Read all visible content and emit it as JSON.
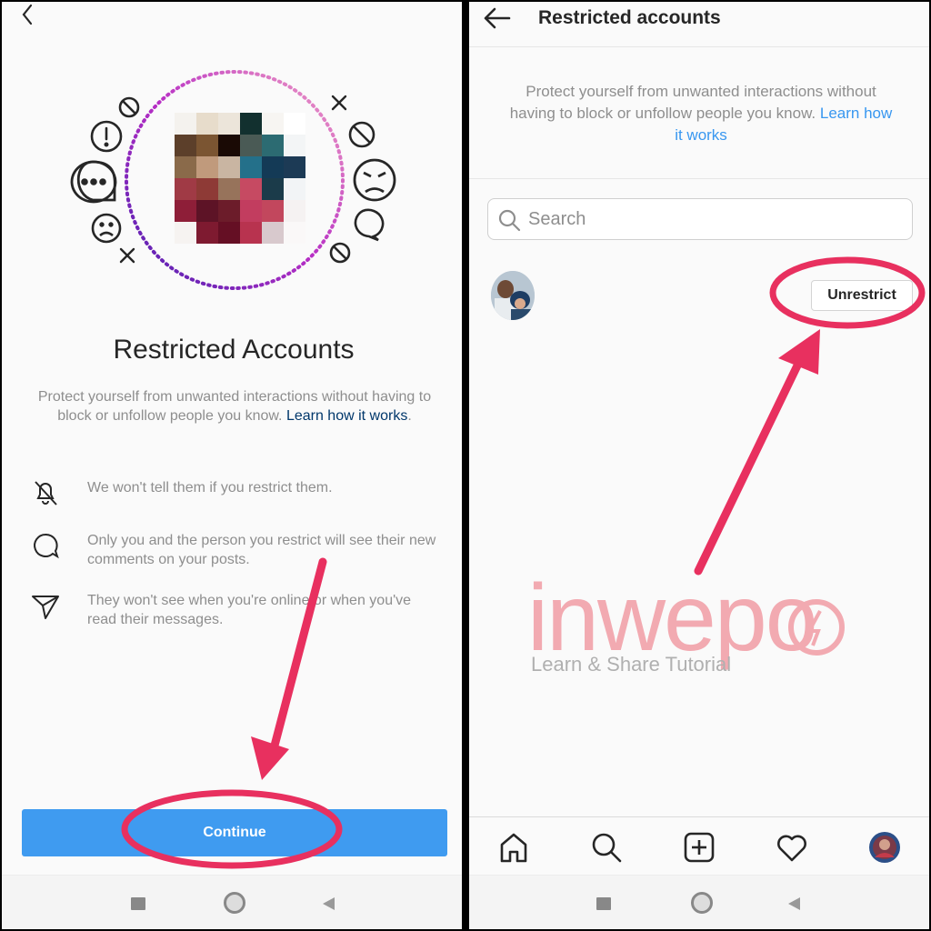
{
  "left": {
    "title": "Restricted Accounts",
    "description": "Protect yourself from unwanted interactions without having to block or unfollow people you know.",
    "link": "Learn how it works",
    "link_suffix": ".",
    "features": [
      {
        "icon": "bell-off-icon",
        "text": "We won't tell them if you restrict them."
      },
      {
        "icon": "comment-bubble-icon",
        "text": "Only you and the person you restrict will see their new comments on your posts."
      },
      {
        "icon": "paper-plane-icon",
        "text": "They won't see when you're online or when you've read their messages."
      }
    ],
    "continue_label": "Continue",
    "avatar_pixels": [
      "#f4f2ee",
      "#e7dccb",
      "#ece5da",
      "#12302f",
      "#f7f5f2",
      "#ffffff",
      "#5c3f2a",
      "#7b5532",
      "#1a0a05",
      "#4a5a55",
      "#2c6b72",
      "#f3f5f6",
      "#8a6a4a",
      "#c09a7c",
      "#c9b5a2",
      "#24708a",
      "#143a56",
      "#1c3a55",
      "#a03a45",
      "#8e3a36",
      "#97735b",
      "#c64a62",
      "#1b3b4a",
      "#f2f4f6",
      "#8e1e38",
      "#5d1326",
      "#6c1c2a",
      "#c23d5f",
      "#c2475d",
      "#f5f2f2",
      "#f6f3f1",
      "#7e1a30",
      "#650f24",
      "#b8334f",
      "#d8c9cd",
      "#faf8f8"
    ]
  },
  "right": {
    "title": "Restricted accounts",
    "description": "Protect yourself from unwanted interactions without having to block or unfollow people you know.",
    "link": "Learn how it works",
    "search_placeholder": "Search",
    "unrestrict_label": "Unrestrict",
    "tabs": [
      "home-icon",
      "search-icon",
      "new-post-icon",
      "heart-icon",
      "profile-avatar"
    ]
  },
  "watermark": {
    "brand": "inwepo",
    "tagline": "Learn & Share Tutorial"
  },
  "colors": {
    "button_blue": "#3f9bf0",
    "annotation_pink": "#e8305f",
    "link_dark": "#00376b",
    "link_blue": "#3897f0"
  }
}
